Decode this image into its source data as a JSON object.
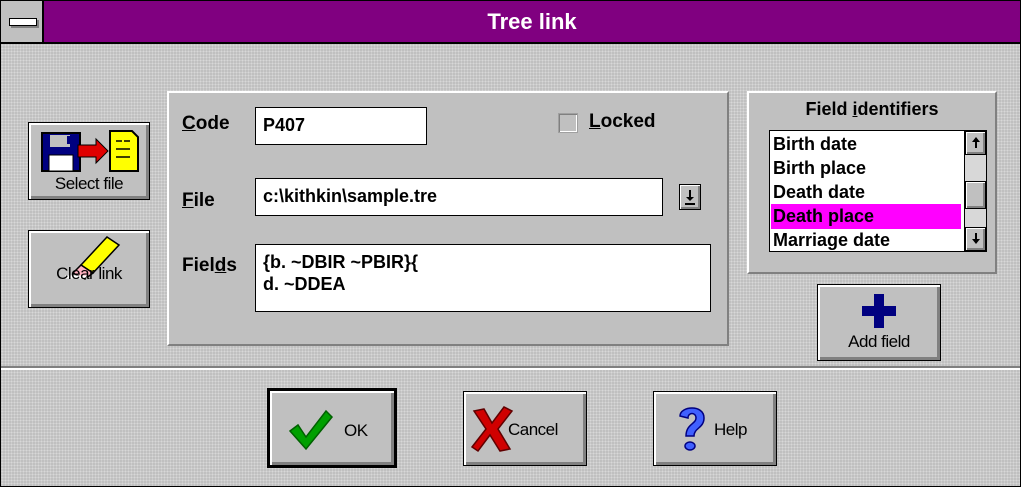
{
  "window": {
    "title": "Tree link"
  },
  "left_buttons": {
    "select_file": "Select file",
    "clear_link": "Clear link"
  },
  "form": {
    "code_label": "Code",
    "code_value": "P407",
    "locked_label": "Locked",
    "locked_checked": false,
    "file_label": "File",
    "file_value": "c:\\kithkin\\sample.tre",
    "fields_label": "Fields",
    "fields_value": "{b. ~DBIR ~PBIR}{\nd. ~DDEA"
  },
  "field_identifiers": {
    "title": "Field identifiers",
    "items": [
      "Birth date",
      "Birth place",
      "Death date",
      "Death place",
      "Marriage date"
    ],
    "selected": "Death place"
  },
  "add_field": {
    "label": "Add field"
  },
  "bottom_buttons": {
    "ok": "OK",
    "cancel": "Cancel",
    "help": "Help"
  },
  "colors": {
    "title_bar": "#800080",
    "selection": "#ff00ff",
    "face": "#c0c0c0"
  }
}
